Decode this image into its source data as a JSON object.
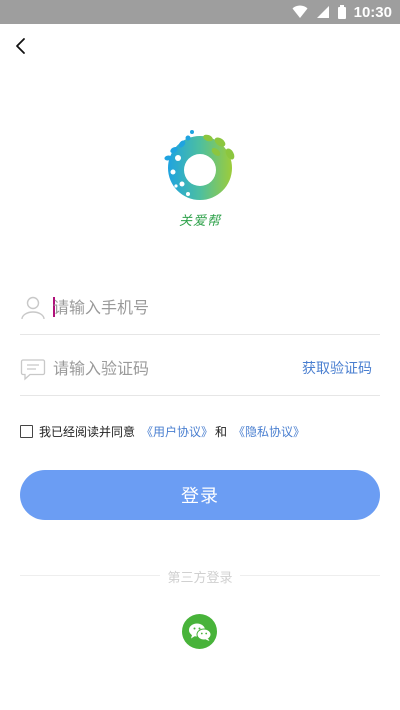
{
  "status_bar": {
    "time": "10:30",
    "icons": [
      "wifi-icon",
      "cellular-icon",
      "battery-icon"
    ]
  },
  "nav": {
    "back_icon": "chevron-left-icon"
  },
  "logo": {
    "text": "关爱帮"
  },
  "phone": {
    "placeholder": "请输入手机号",
    "icon": "user-icon"
  },
  "code": {
    "placeholder": "请输入验证码",
    "icon": "message-icon",
    "get_code_label": "获取验证码"
  },
  "agreement": {
    "checked": false,
    "text": "我已经阅读并同意",
    "user_agreement": "《用户协议》",
    "and": "和",
    "privacy_agreement": "《隐私协议》"
  },
  "login_button": "登录",
  "third_party": {
    "label": "第三方登录",
    "providers": [
      "wechat-icon"
    ]
  },
  "colors": {
    "primary": "#6b9df3",
    "link": "#4a7fd0",
    "wechat": "#48b33a",
    "status_bar": "#9e9e9e"
  }
}
